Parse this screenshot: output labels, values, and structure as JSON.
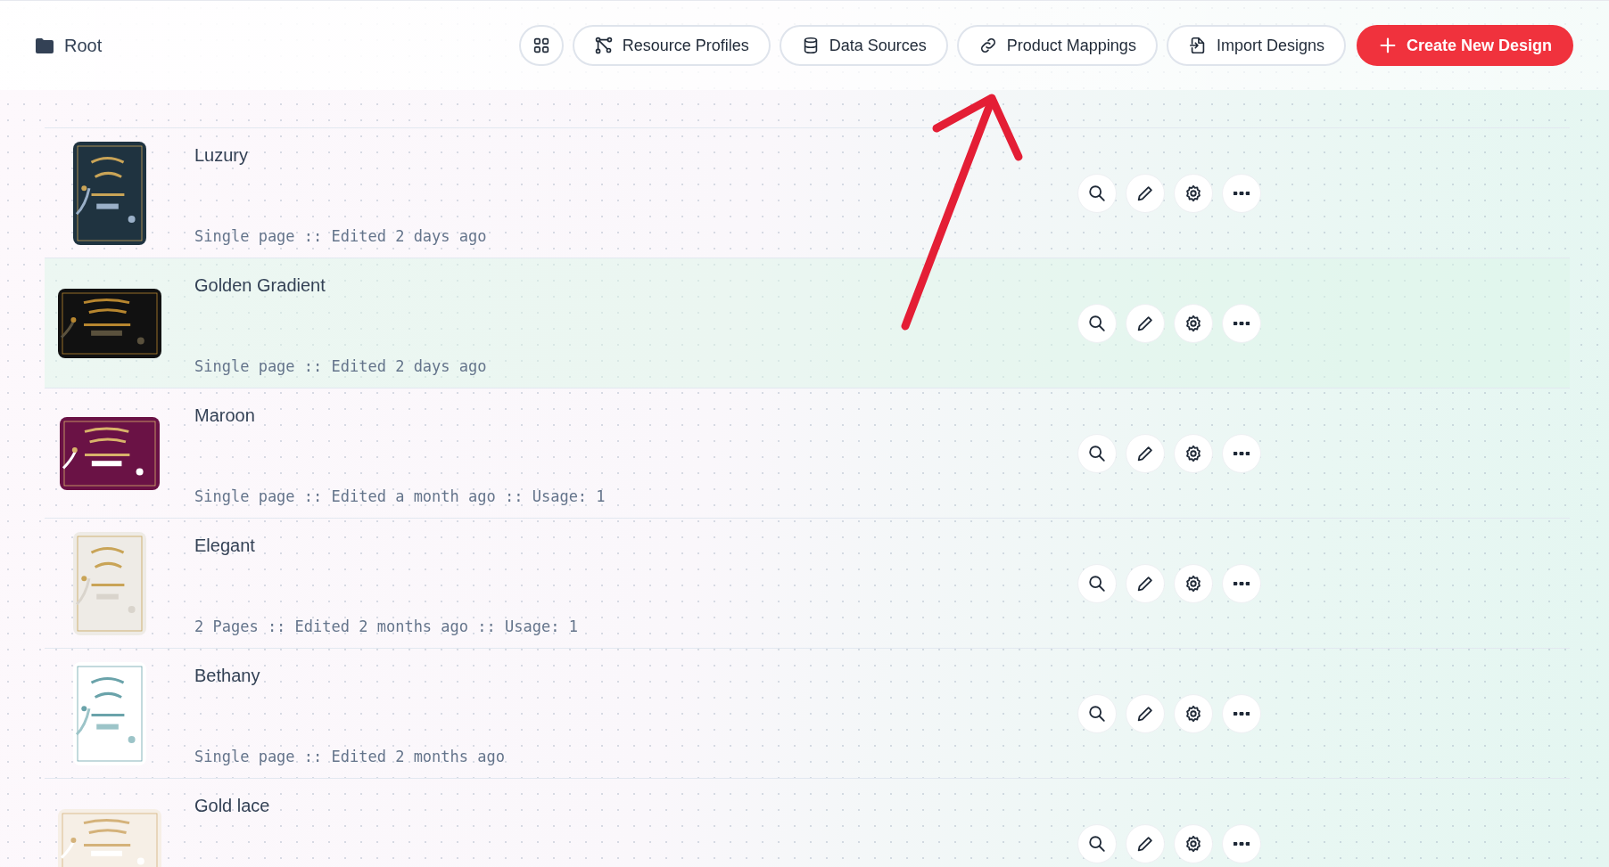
{
  "breadcrumb": {
    "label": "Root"
  },
  "toolbar": {
    "buttons": [
      {
        "label": "Resource Profiles"
      },
      {
        "label": "Data Sources"
      },
      {
        "label": "Product Mappings"
      },
      {
        "label": "Import Designs"
      }
    ],
    "primary": {
      "label": "Create New Design"
    }
  },
  "designs": [
    {
      "name": "Luzury",
      "meta": "Single page :: Edited 2 days ago",
      "highlighted": false
    },
    {
      "name": "Golden Gradient",
      "meta": "Single page :: Edited 2 days ago",
      "highlighted": true
    },
    {
      "name": "Maroon",
      "meta": "Single page :: Edited a month ago :: Usage: 1",
      "highlighted": false
    },
    {
      "name": "Elegant",
      "meta": "2 Pages :: Edited 2 months ago :: Usage: 1",
      "highlighted": false
    },
    {
      "name": "Bethany",
      "meta": "Single page :: Edited 2 months ago",
      "highlighted": false
    },
    {
      "name": "Gold lace",
      "highlighted": false
    }
  ]
}
